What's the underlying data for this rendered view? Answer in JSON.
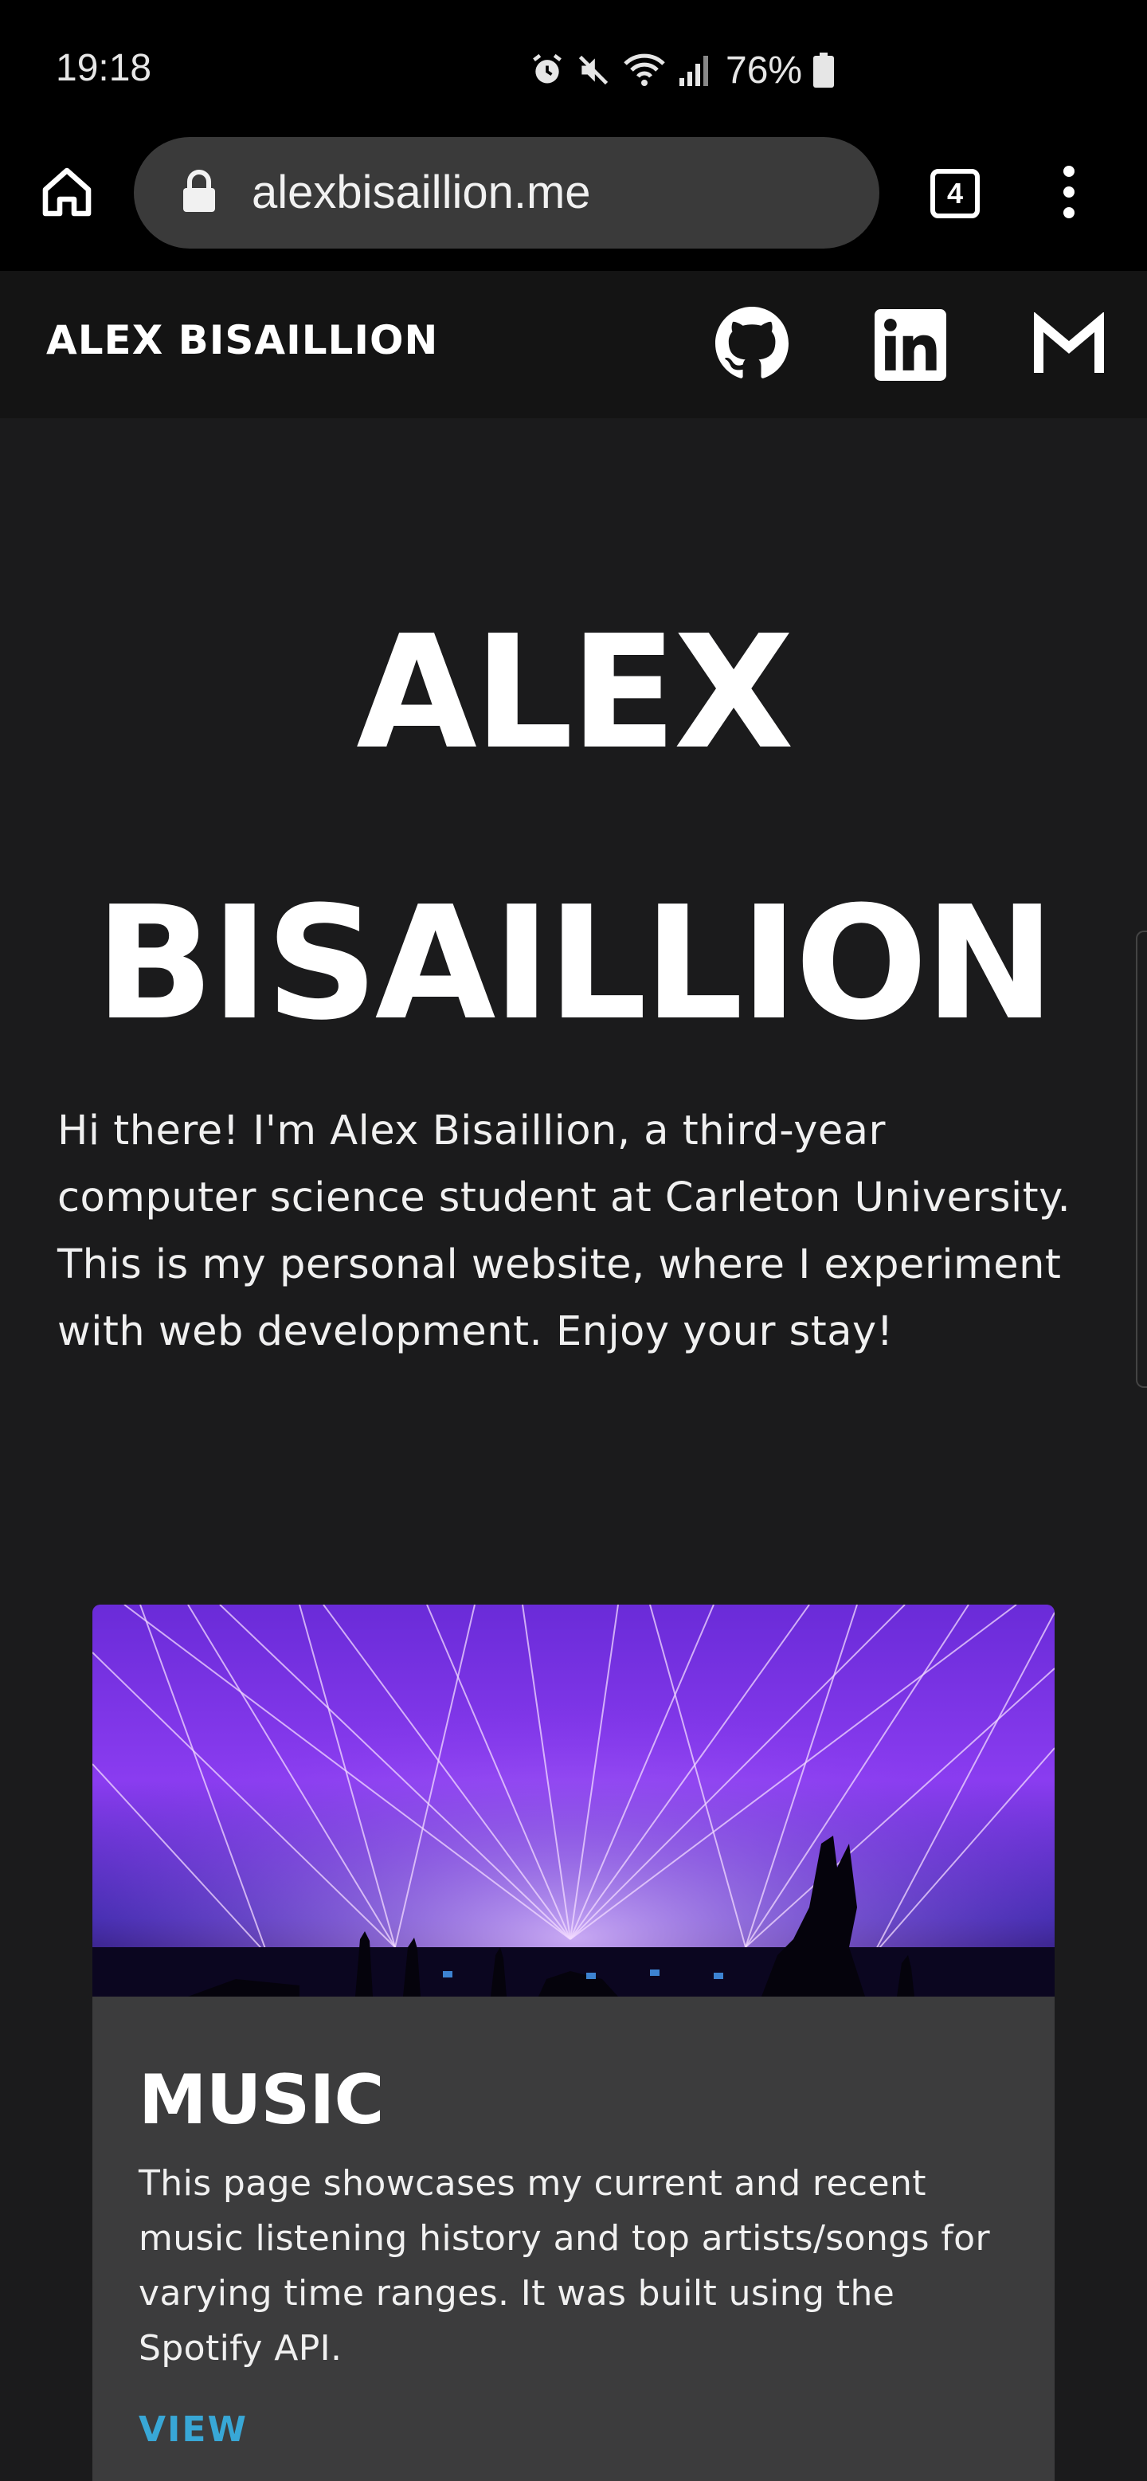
{
  "status_bar": {
    "time": "19:18",
    "battery": "76%",
    "icons": [
      "alarm-icon",
      "mute-icon",
      "wifi-icon",
      "signal-icon",
      "battery-icon"
    ]
  },
  "browser": {
    "url": "alexbisaillion.me",
    "tab_count": "4",
    "icons": [
      "home-icon",
      "lock-icon",
      "tabs-icon",
      "more-vert-icon"
    ]
  },
  "site": {
    "brand": "ALEX BISAILLION",
    "social": [
      "github-icon",
      "linkedin-icon",
      "gmail-icon"
    ]
  },
  "hero": {
    "title_line1": "ALEX",
    "title_line2": "BISAILLION",
    "intro": "Hi there! I'm Alex Bisaillion, a third-year computer science student at Carleton University. This is my personal website, where I experiment with web development. Enjoy your stay!"
  },
  "card": {
    "title": "MUSIC",
    "description": "This page showcases my current and recent music listening history and top artists/songs for varying time ranges. It was built using the Spotify API.",
    "link_label": "VIEW"
  },
  "colors": {
    "page_bg": "#1b1b1c",
    "header_bg": "#141414",
    "card_bg": "#3c3c3d",
    "url_bar_bg": "#3a3a3a",
    "accent_link": "#38a7d6",
    "concert_purple": "#8a3cf0"
  }
}
